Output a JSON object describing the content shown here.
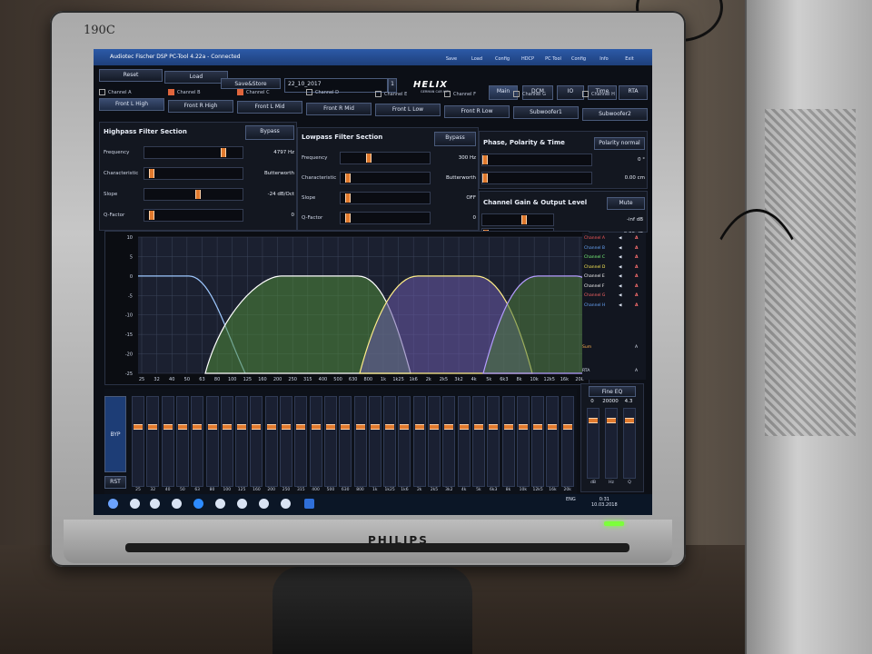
{
  "monitor": {
    "model": "190C",
    "brand": "PHILIPS"
  },
  "window": {
    "title": "Audiotec Fischer DSP PC-Tool 4.22a - Connected"
  },
  "toolbar_icons": [
    "Save",
    "Load",
    "Config",
    "HDCP",
    "PC Tool",
    "Config",
    "Info",
    "Exit"
  ],
  "toolbar": {
    "reset": "Reset",
    "load": "Load",
    "save_store": "Save&Store",
    "preset_name": "22_10_2017",
    "preset_slot": "1",
    "logo": "HELIX",
    "logo_sub": "GERMAN CAR HIFI",
    "nav": [
      "Main",
      "DCM",
      "IO",
      "Time",
      "RTA"
    ]
  },
  "channels": [
    {
      "header": "Channel A",
      "button": "Front L High",
      "checked": false
    },
    {
      "header": "Channel B",
      "button": "Front R High",
      "checked": true
    },
    {
      "header": "Channel C",
      "button": "Front L Mid",
      "checked": true
    },
    {
      "header": "Channel D",
      "button": "Front R Mid",
      "checked": false
    },
    {
      "header": "Channel E",
      "button": "Front L Low",
      "checked": false
    },
    {
      "header": "Channel F",
      "button": "Front R Low",
      "checked": false
    },
    {
      "header": "Channel G",
      "button": "Subwoofer1",
      "checked": false
    },
    {
      "header": "Channel H",
      "button": "Subwoofer2",
      "checked": false
    }
  ],
  "highpass": {
    "title": "Highpass Filter Section",
    "bypass": "Bypass",
    "rows": [
      {
        "label": "Frequency",
        "value": "4797 Hz",
        "pos": 0.82
      },
      {
        "label": "Characteristic",
        "value": "Butterworth",
        "pos": 0.05
      },
      {
        "label": "Slope",
        "value": "-24 dB/Oct",
        "pos": 0.55
      },
      {
        "label": "Q-Factor",
        "value": "0",
        "pos": 0.05
      }
    ]
  },
  "lowpass": {
    "title": "Lowpass Filter Section",
    "bypass": "Bypass",
    "rows": [
      {
        "label": "Frequency",
        "value": "300 Hz",
        "pos": 0.3
      },
      {
        "label": "Characteristic",
        "value": "Butterworth",
        "pos": 0.05
      },
      {
        "label": "Slope",
        "value": "OFF",
        "pos": 0.05
      },
      {
        "label": "Q-Factor",
        "value": "0",
        "pos": 0.05
      }
    ]
  },
  "phase": {
    "title": "Phase, Polarity & Time",
    "polarity": "Polarity normal",
    "rows": [
      {
        "value": "0 °",
        "pos": 0.0
      },
      {
        "value": "0.00 cm",
        "pos": 0.0
      }
    ]
  },
  "gain": {
    "title": "Channel Gain & Output Level",
    "mute": "Mute",
    "rows": [
      {
        "value": "-inf dB",
        "pos": 0.6
      },
      {
        "value": "0.00 dB",
        "pos": 0.02
      }
    ]
  },
  "graph": {
    "y_ticks": [
      "10",
      "5",
      "0",
      "-5",
      "-10",
      "-15",
      "-20",
      "-25"
    ],
    "x_ticks": [
      "25",
      "32",
      "40",
      "50",
      "63",
      "80",
      "100",
      "125",
      "160",
      "200",
      "250",
      "315",
      "400",
      "500",
      "630",
      "800",
      "1k",
      "1k25",
      "1k6",
      "2k",
      "2k5",
      "3k2",
      "4k",
      "5k",
      "6k3",
      "8k",
      "10k",
      "12k5",
      "16k",
      "20k"
    ]
  },
  "channel_list": [
    {
      "name": "Channel A",
      "color": "#ff5a5a",
      "mute": "A"
    },
    {
      "name": "Channel B",
      "color": "#6aa9ff",
      "mute": "A"
    },
    {
      "name": "Channel C",
      "color": "#7dff7d",
      "mute": "A"
    },
    {
      "name": "Channel D",
      "color": "#ffee55",
      "mute": "A"
    },
    {
      "name": "Channel E",
      "color": "#ffffff",
      "mute": "A"
    },
    {
      "name": "Channel F",
      "color": "#ffffff",
      "mute": "A"
    },
    {
      "name": "Channel G",
      "color": "#ff6666",
      "mute": "A"
    },
    {
      "name": "Channel H",
      "color": "#6aa9ff",
      "mute": "A"
    }
  ],
  "side_labels": {
    "sum": "Sum",
    "rta": "RTA",
    "sum_value": "A",
    "rta_value": "A"
  },
  "eq": {
    "byp": "BYP",
    "rst": "RST",
    "bands": [
      "25",
      "32",
      "40",
      "50",
      "63",
      "80",
      "100",
      "125",
      "160",
      "200",
      "250",
      "315",
      "400",
      "500",
      "630",
      "800",
      "1k",
      "1k25",
      "1k6",
      "2k",
      "2k5",
      "3k2",
      "4k",
      "5k",
      "6k3",
      "8k",
      "10k",
      "12k5",
      "16k",
      "20k"
    ],
    "fine_label": "Fine EQ",
    "fine_values": [
      "0",
      "20000",
      "4.3"
    ],
    "fine_units": [
      "dB",
      "Hz",
      "Q"
    ]
  },
  "taskbar": {
    "time": "0:31",
    "date": "10.03.2018",
    "lang": "ENG"
  }
}
